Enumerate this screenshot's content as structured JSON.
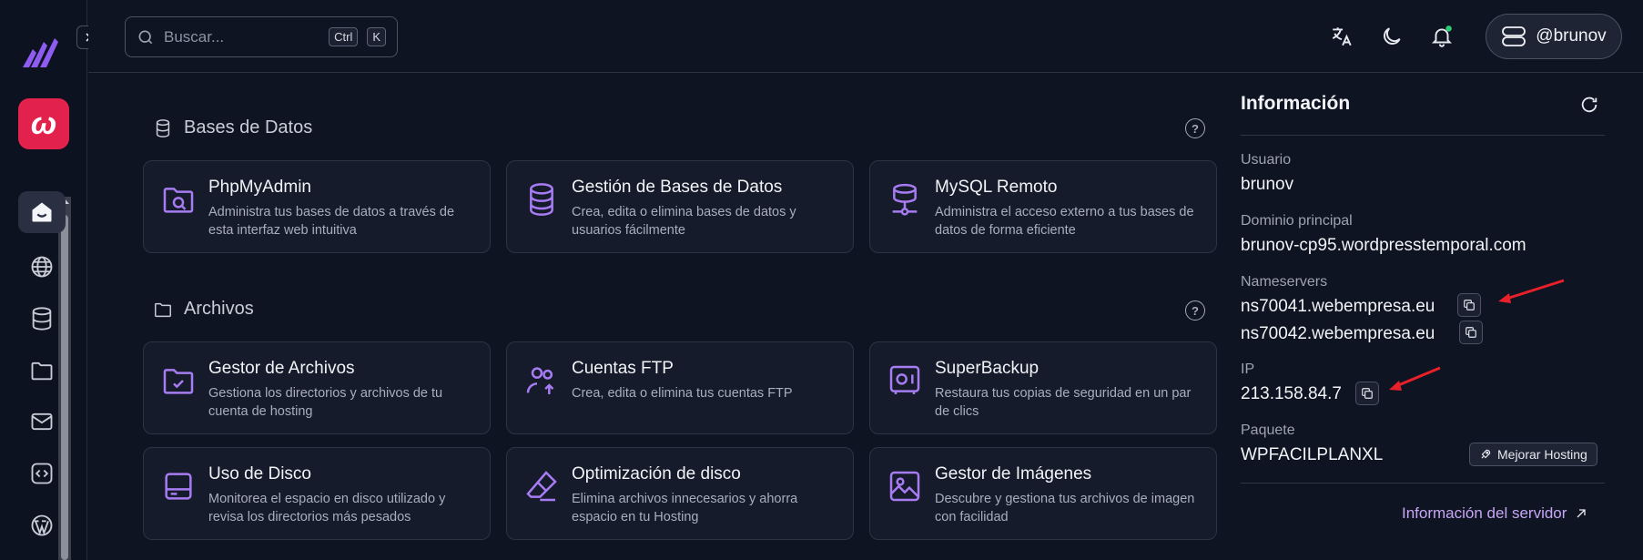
{
  "topbar": {
    "search_placeholder": "Buscar...",
    "shortcut_ctrl": "Ctrl",
    "shortcut_k": "K",
    "username": "@brunov",
    "notification_dot_color": "#2ecc71"
  },
  "brand": {
    "accent": "#e2214c",
    "logo_color": "#8e5cf0"
  },
  "nav": [
    "home-icon",
    "globe-icon",
    "database-icon",
    "folder-icon",
    "mail-icon",
    "code-icon",
    "wordpress-icon"
  ],
  "sections": [
    {
      "title": "Bases de Datos",
      "cards": [
        {
          "title": "PhpMyAdmin",
          "desc": "Administra tus bases de datos a través de esta interfaz web intuitiva",
          "icon": "folder-search-icon"
        },
        {
          "title": "Gestión de Bases de Datos",
          "desc": "Crea, edita o elimina bases de datos y usuarios fácilmente",
          "icon": "database-icon"
        },
        {
          "title": "MySQL Remoto",
          "desc": "Administra el acceso externo a tus bases de datos de forma eficiente",
          "icon": "network-database-icon"
        }
      ]
    },
    {
      "title": "Archivos",
      "cards": [
        {
          "title": "Gestor de Archivos",
          "desc": "Gestiona los directorios y archivos de tu cuenta de hosting",
          "icon": "folder-check-icon"
        },
        {
          "title": "Cuentas FTP",
          "desc": "Crea, edita o elimina tus cuentas FTP",
          "icon": "users-upload-icon"
        },
        {
          "title": "SuperBackup",
          "desc": "Restaura tus copias de seguridad en un par de clics",
          "icon": "safe-icon"
        },
        {
          "title": "Uso de Disco",
          "desc": "Monitorea el espacio en disco utilizado y revisa los directorios más pesados",
          "icon": "hard-drive-icon"
        },
        {
          "title": "Optimización de disco",
          "desc": "Elimina archivos innecesarios y ahorra espacio en tu Hosting",
          "icon": "eraser-icon"
        },
        {
          "title": "Gestor de Imágenes",
          "desc": "Descubre y gestiona tus archivos de imagen con facilidad",
          "icon": "image-icon"
        }
      ]
    }
  ],
  "info": {
    "title": "Información",
    "usuario_label": "Usuario",
    "usuario": "brunov",
    "dominio_label": "Dominio principal",
    "dominio": "brunov-cp95.wordpresstemporal.com",
    "ns_label": "Nameservers",
    "ns1": "ns70041.webempresa.eu",
    "ns2": "ns70042.webempresa.eu",
    "ip_label": "IP",
    "ip": "213.158.84.7",
    "paquete_label": "Paquete",
    "paquete": "WPFACILPLANXL",
    "upgrade": "Mejorar Hosting",
    "server_link": "Información del servidor"
  },
  "accent_icon_color": "#a77cf2",
  "annotation_color": "#e8202a"
}
